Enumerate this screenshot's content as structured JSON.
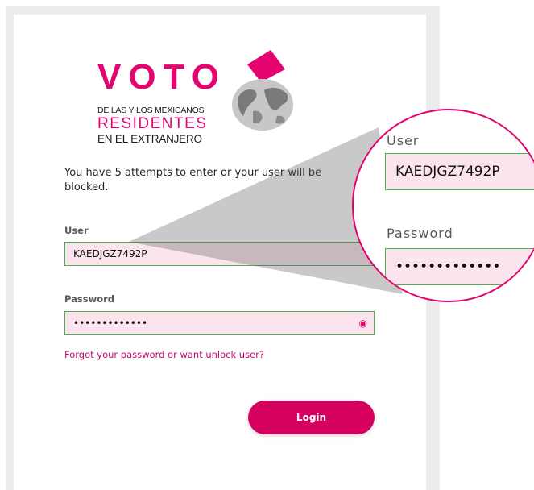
{
  "logo": {
    "line1": "VOTO",
    "line2": "DE LAS Y LOS MEXICANOS",
    "line3": "RESIDENTES",
    "line4": "EN EL EXTRANJERO",
    "icon": "globe-with-ballot-icon"
  },
  "notice": "You have 5 attempts to enter or your user will be blocked.",
  "user": {
    "label": "User",
    "value": "KAEDJGZ7492P"
  },
  "password": {
    "label": "Password",
    "value": "•••••••••••••",
    "toggle_icon": "eye-icon"
  },
  "forgot_link": "Forgot your password or want unlock user?",
  "login_button": "Login",
  "zoom": {
    "user_label": "User",
    "user_value": "KAEDJGZ7492P",
    "password_label": "Password",
    "password_value": "•••••••••••••"
  },
  "colors": {
    "accent": "#e3046f",
    "button": "#d6005f",
    "field_bg": "#fce4ef",
    "field_border": "#4caf50"
  }
}
